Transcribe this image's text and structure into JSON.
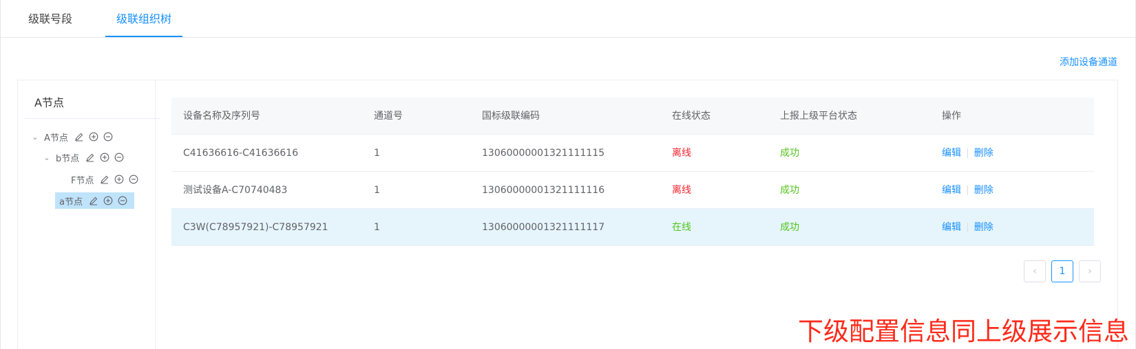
{
  "tabs": [
    {
      "label": "级联号段"
    },
    {
      "label": "级联组织树",
      "active": true
    }
  ],
  "actions": {
    "add_channel": "添加设备通道"
  },
  "tree": {
    "title": "A节点",
    "nodes": [
      {
        "label": "A节点",
        "level": 0,
        "expanded": true
      },
      {
        "label": "b节点",
        "level": 1,
        "expanded": true
      },
      {
        "label": "F节点",
        "level": 2
      },
      {
        "label": "a节点",
        "level": 1,
        "selected": true
      }
    ],
    "icons": [
      "edit-icon",
      "add-circle-icon",
      "remove-circle-icon"
    ]
  },
  "table": {
    "columns": [
      "设备名称及序列号",
      "通道号",
      "国标级联编码",
      "在线状态",
      "上报上级平台状态",
      "操作"
    ],
    "rows": [
      {
        "name": "C41636616-C41636616",
        "channel": "1",
        "code": "13060000001321111115",
        "online": "离线",
        "report": "成功"
      },
      {
        "name": "测试设备A-C70740483",
        "channel": "1",
        "code": "13060000001321111116",
        "online": "离线",
        "report": "成功"
      },
      {
        "name": "C3W(C78957921)-C78957921",
        "channel": "1",
        "code": "13060000001321111117",
        "online": "在线",
        "report": "成功"
      }
    ],
    "op_edit": "编辑",
    "op_delete": "删除"
  },
  "pagination": {
    "current": "1",
    "prev": "‹",
    "next": "›"
  },
  "colors": {
    "accent": "#1890ff",
    "offline": "#f5222d",
    "online": "#52c41a",
    "success": "#52c41a",
    "overlay": "#ff2a1a"
  },
  "annotation": "下级配置信息同上级展示信息"
}
